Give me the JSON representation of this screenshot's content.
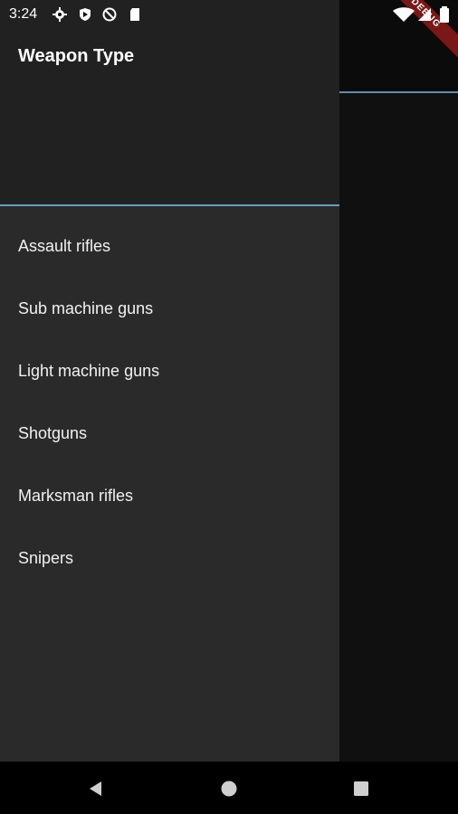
{
  "status_bar": {
    "time": "3:24",
    "left_icons": [
      "settings-icon",
      "shield-icon",
      "blocked-icon",
      "sd-card-icon"
    ],
    "right_icons": [
      "wifi-icon",
      "signal-icon",
      "battery-icon"
    ]
  },
  "debug_banner": {
    "label": "DEBUG"
  },
  "drawer": {
    "title": "Weapon Type",
    "items": [
      {
        "label": "Assault rifles"
      },
      {
        "label": "Sub machine guns"
      },
      {
        "label": "Light machine guns"
      },
      {
        "label": "Shotguns"
      },
      {
        "label": "Marksman rifles"
      },
      {
        "label": "Snipers"
      }
    ]
  },
  "nav_bar": {
    "buttons": [
      "back-icon",
      "home-icon",
      "recents-icon"
    ]
  },
  "colors": {
    "drawer_bg": "#2a2a2a",
    "drawer_header_bg": "#212121",
    "accent_divider": "#6a9ec0",
    "debug_banner": "#7a1717",
    "scrim_bg": "#101010"
  }
}
